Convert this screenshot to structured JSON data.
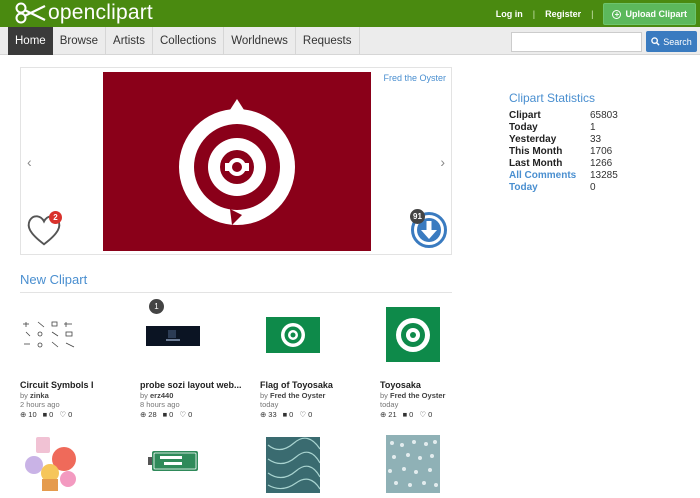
{
  "brand": {
    "name": "openclipart"
  },
  "top_links": {
    "login": "Log in",
    "register": "Register",
    "upload": "Upload Clipart"
  },
  "nav": {
    "items": [
      "Home",
      "Browse",
      "Artists",
      "Collections",
      "Worldnews",
      "Requests"
    ],
    "search_button": "Search",
    "search_placeholder": ""
  },
  "featured": {
    "author": "Fred the Oyster",
    "image_bg": "#8a0019",
    "favorites": "2",
    "downloads": "91"
  },
  "stats": {
    "title": "Clipart Statistics",
    "rows": [
      {
        "label": "Clipart",
        "value": "65803"
      },
      {
        "label": "Today",
        "value": "1"
      },
      {
        "label": "Yesterday",
        "value": "33"
      },
      {
        "label": "This Month",
        "value": "1706"
      },
      {
        "label": "Last Month",
        "value": "1266"
      },
      {
        "label": "All Comments",
        "value": "13285"
      },
      {
        "label": "Today",
        "value": "0"
      }
    ]
  },
  "new_clipart": {
    "title": "New Clipart",
    "cards": [
      {
        "title": "Circuit Symbols I",
        "by_prefix": "by",
        "author": "zinka",
        "time": "2 hours ago",
        "downloads": "10",
        "comments": "0",
        "favorites": "0"
      },
      {
        "title": "probe sozi layout web...",
        "by_prefix": "by",
        "author": "erz440",
        "time": "8 hours ago",
        "downloads": "28",
        "comments": "0",
        "favorites": "0",
        "badge": "1"
      },
      {
        "title": "Flag of Toyosaka",
        "by_prefix": "by",
        "author": "Fred the Oyster",
        "time": "today",
        "downloads": "33",
        "comments": "0",
        "favorites": "0"
      },
      {
        "title": "Toyosaka",
        "by_prefix": "by",
        "author": "Fred the Oyster",
        "time": "today",
        "downloads": "21",
        "comments": "0",
        "favorites": "0"
      }
    ]
  },
  "colors": {
    "topbar": "#4a8a10",
    "accent": "#4a8fd0",
    "search_btn": "#3a7bc0",
    "toyosaka_green": "#0e8a4a"
  }
}
